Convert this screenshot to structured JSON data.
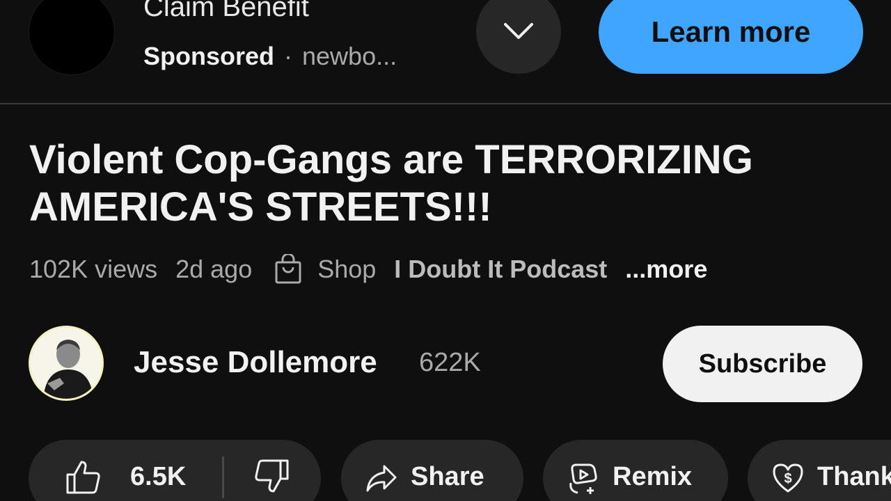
{
  "ad": {
    "title": "Claim Benefit",
    "sponsored_label": "Sponsored",
    "separator": "·",
    "domain": "newbo...",
    "cta_label": "Learn more",
    "cta_color": "#3ea6ff"
  },
  "video": {
    "title": "Violent Cop-Gangs are TERRORIZING AMERICA'S STREETS!!!",
    "views": "102K views",
    "age": "2d ago",
    "shop_label": "Shop",
    "podcast_label": "I Doubt It Podcast",
    "more_label": "...more"
  },
  "channel": {
    "name": "Jesse Dollemore",
    "subscribers": "622K",
    "subscribe_label": "Subscribe"
  },
  "actions": {
    "like_count": "6.5K",
    "share_label": "Share",
    "remix_label": "Remix",
    "thanks_label": "Thanks"
  },
  "icons": {
    "chevron": "chevron-down-icon",
    "shop": "shopping-bag-icon",
    "like": "thumbs-up-icon",
    "dislike": "thumbs-down-icon",
    "share": "share-arrow-icon",
    "remix": "remix-icon",
    "thanks": "heart-dollar-icon"
  },
  "colors": {
    "background": "#0f0f0f",
    "pill": "#272727",
    "subscribe_bg": "#f1f1f1"
  }
}
